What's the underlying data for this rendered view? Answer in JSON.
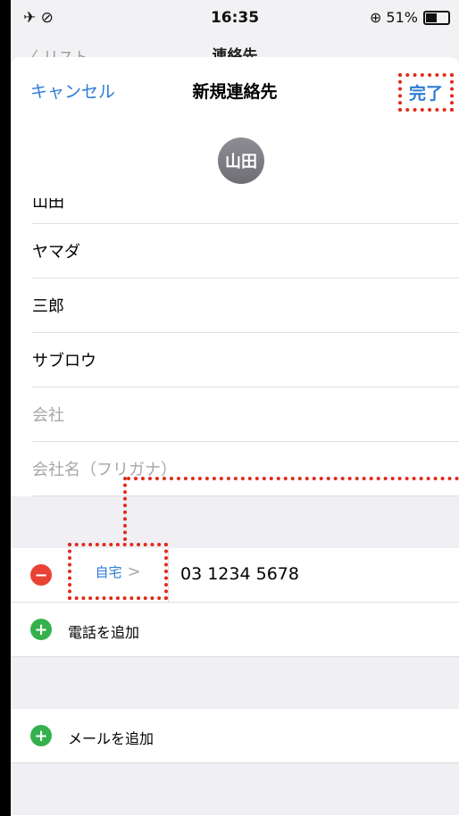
{
  "status": {
    "left_icons": "✈ ⊘",
    "time": "16:35",
    "right_text": "⊕ 51%"
  },
  "background": {
    "back_label": "〈 リスト",
    "title": "連絡先"
  },
  "nav": {
    "cancel": "キャンセル",
    "title": "新規連絡先",
    "done": "完了"
  },
  "avatar": {
    "initials": "山田"
  },
  "fields": {
    "last_name": "山田",
    "last_name_kana": "ヤマダ",
    "first_name": "三郎",
    "first_name_kana": "サブロウ",
    "company_placeholder": "会社",
    "company_kana_placeholder": "会社名（フリガナ）"
  },
  "phone": {
    "label": "自宅",
    "chevron": ">",
    "number": "03 1234 5678",
    "add": "電話を追加"
  },
  "email": {
    "add": "メールを追加"
  },
  "colors": {
    "accent": "#2e7bd6",
    "annotation": "#e22a1a",
    "delete": "#ea4135",
    "add": "#34b14d"
  }
}
